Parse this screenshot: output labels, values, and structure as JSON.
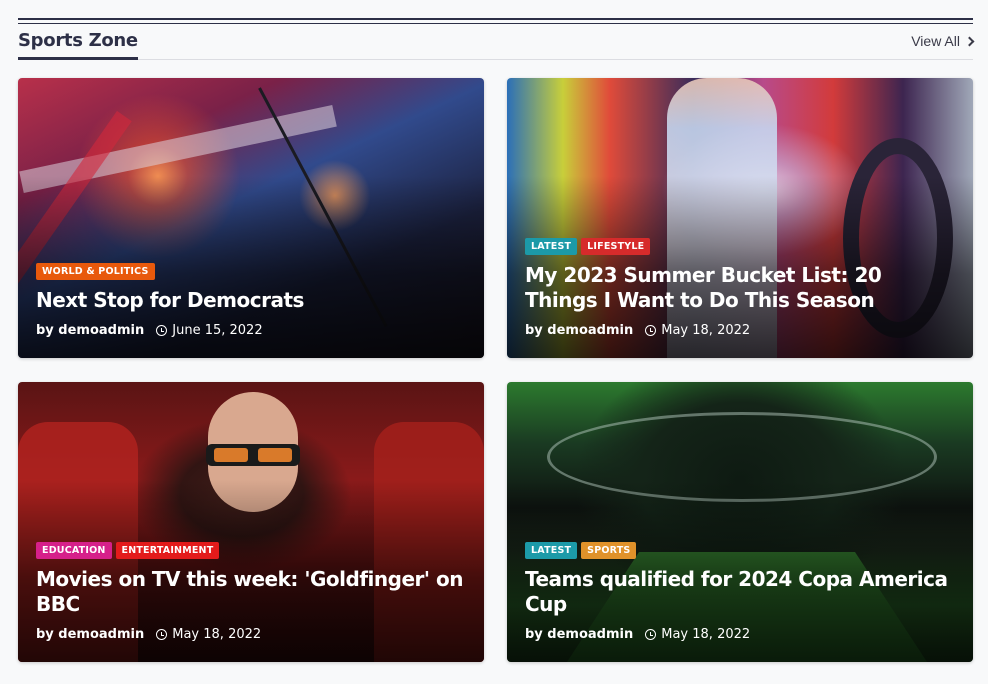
{
  "section": {
    "title": "Sports Zone",
    "view_all": "View All"
  },
  "colors": {
    "accent": "#2d3047",
    "category_world_politics": "#e8590c",
    "category_latest": "#1c9aa8",
    "category_lifestyle": "#d62b2b",
    "category_education": "#d6208a",
    "category_entertainment": "#e31b1b",
    "category_sports": "#e0922a"
  },
  "posts": [
    {
      "categories": [
        "WORLD & POLITICS"
      ],
      "title": "Next Stop for Democrats",
      "author": "by demoadmin",
      "date": "June 15, 2022",
      "icon": "clock-icon"
    },
    {
      "categories": [
        "LATEST",
        "LIFESTYLE"
      ],
      "title": "My 2023 Summer Bucket List: 20 Things I Want to Do This Season",
      "author": "by demoadmin",
      "date": "May 18, 2022",
      "icon": "clock-icon"
    },
    {
      "categories": [
        "EDUCATION",
        "ENTERTAINMENT"
      ],
      "title": "Movies on TV this week: 'Goldfinger' on BBC",
      "author": "by demoadmin",
      "date": "May 18, 2022",
      "icon": "clock-icon"
    },
    {
      "categories": [
        "LATEST",
        "SPORTS"
      ],
      "title": "Teams qualified for 2024 Copa America Cup",
      "author": "by demoadmin",
      "date": "May 18, 2022",
      "icon": "clock-icon"
    }
  ]
}
